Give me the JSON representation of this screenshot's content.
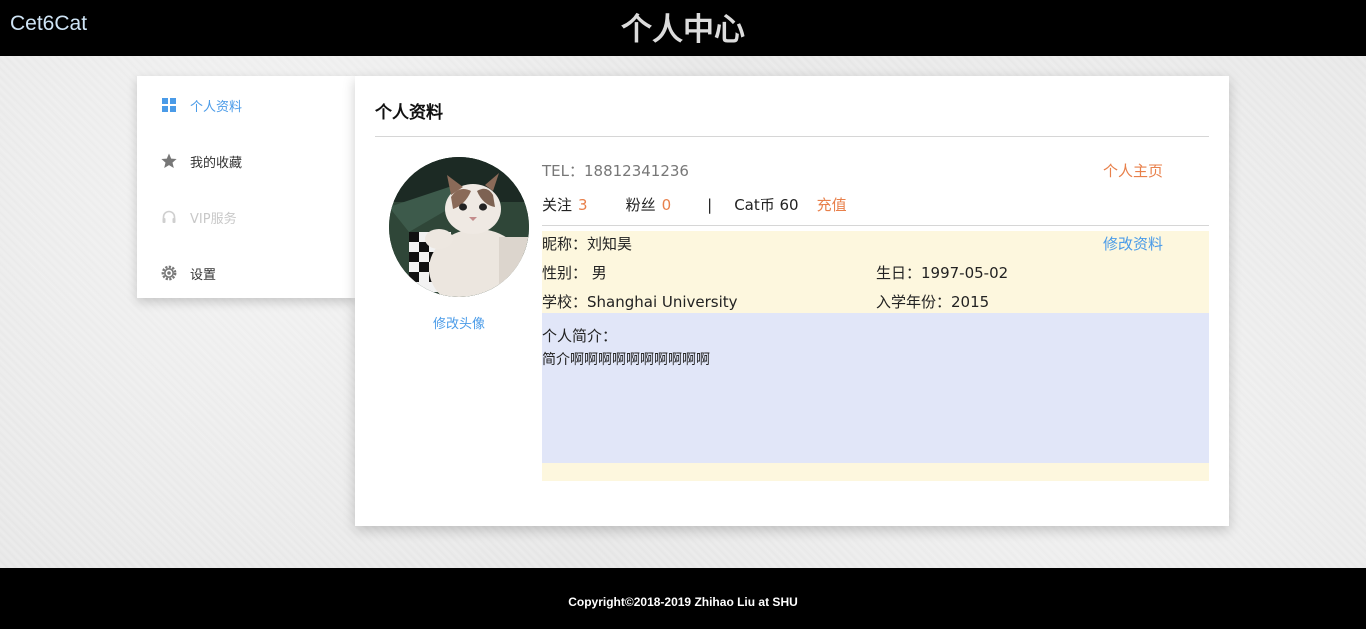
{
  "header": {
    "brand": "Cet6Cat",
    "title": "个人中心"
  },
  "sidebar": {
    "items": [
      {
        "label": "个人资料",
        "icon": "grid-icon",
        "state": "active"
      },
      {
        "label": "我的收藏",
        "icon": "star-icon",
        "state": "normal"
      },
      {
        "label": "VIP服务",
        "icon": "headset-icon",
        "state": "disabled"
      },
      {
        "label": "设置",
        "icon": "gear-icon",
        "state": "normal"
      }
    ]
  },
  "profile": {
    "heading": "个人资料",
    "change_avatar": "修改头像",
    "tel": "TEL：18812341236",
    "homepage_link": "个人主页",
    "follow_label": "关注",
    "follow_count": "3",
    "fans_label": "粉丝",
    "fans_count": "0",
    "separator": "|",
    "coins": "Cat币 60",
    "recharge": "充值",
    "edit_profile": "修改资料",
    "nickname": "昵称：刘知昊",
    "gender": "性别： 男",
    "birthday": "生日：1997-05-02",
    "school": "学校：Shanghai University",
    "enroll_year": "入学年份：2015",
    "bio_label": "个人简介：",
    "bio_text": "简介啊啊啊啊啊啊啊啊啊啊"
  },
  "footer": {
    "copyright": "Copyright©2018-2019 Zhihao Liu at SHU"
  },
  "colors": {
    "accent_blue": "#4a9be8",
    "accent_orange": "#e8804b",
    "info_bg": "#fdf7de",
    "bio_bg": "#e1e6f8"
  }
}
